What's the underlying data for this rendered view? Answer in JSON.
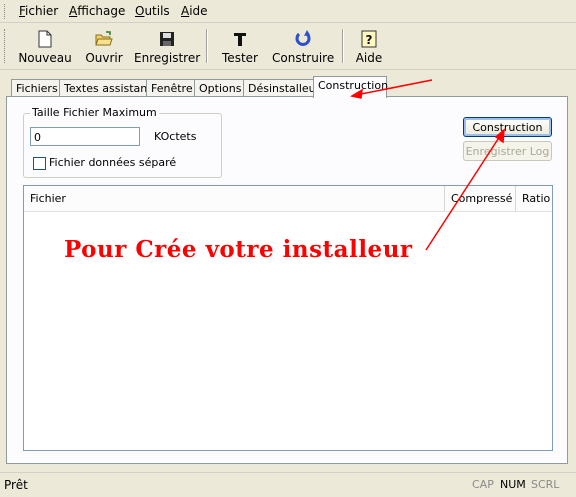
{
  "menu": {
    "items": [
      {
        "mnemonic": "F",
        "rest": "ichier"
      },
      {
        "mnemonic": "A",
        "rest": "ffichage"
      },
      {
        "mnemonic": "O",
        "rest": "utils"
      },
      {
        "mnemonic": "A",
        "rest": "ide"
      }
    ]
  },
  "toolbar": {
    "nouveau": "Nouveau",
    "ouvrir": "Ouvrir",
    "enregistrer": "Enregistrer",
    "tester": "Tester",
    "construire": "Construire",
    "aide": "Aide"
  },
  "tabs": [
    "Fichiers",
    "Textes assistant",
    "Fenêtre",
    "Options",
    "Désinstalleur",
    "Construction"
  ],
  "build": {
    "group_title": "Taille Fichier Maximum",
    "size_value": "0",
    "size_unit": "KOctets",
    "separate_data_label": "Fichier données séparé",
    "separate_data_checked": false,
    "construction_button": "Construction",
    "save_log_button": "Enregistrer Log",
    "columns": [
      "Fichier",
      "Compressé",
      "Ratio"
    ]
  },
  "annotation": "Pour Crée votre installeur",
  "status": {
    "text": "Prêt",
    "cap": "CAP",
    "num": "NUM",
    "scrl": "SCRL"
  },
  "colors": {
    "annotation": "#ff0000",
    "window_bg": "#ece9d8",
    "panel_bg": "#fcfcfe"
  },
  "icons": [
    "new-file-icon",
    "open-folder-icon",
    "save-disk-icon",
    "test-t-icon",
    "build-arrow-icon",
    "help-icon"
  ]
}
